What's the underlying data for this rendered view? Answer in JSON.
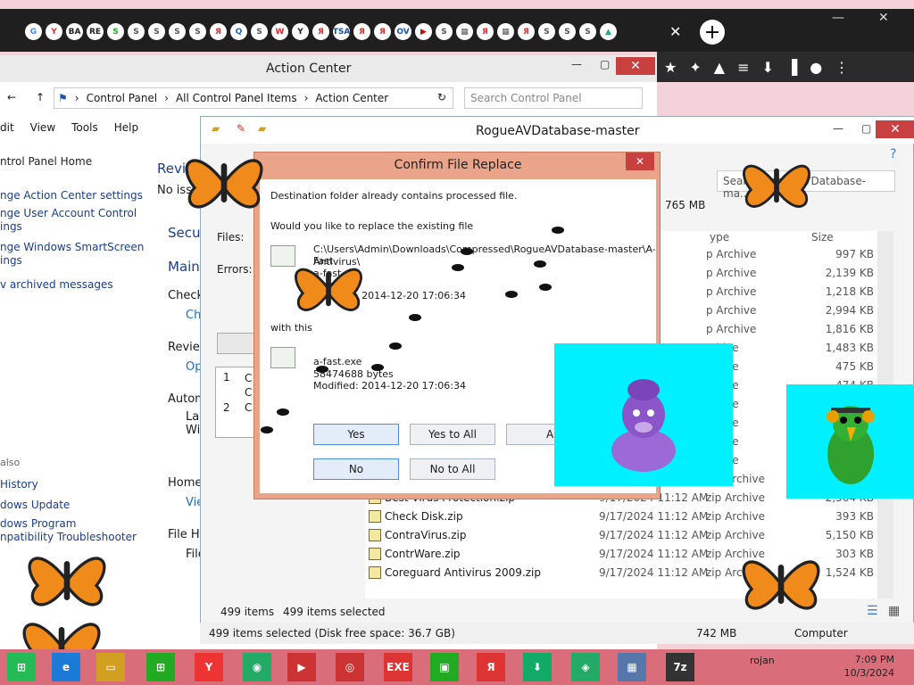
{
  "browser": {
    "tab_icons": [
      "G",
      "Y",
      "BA",
      "RE",
      "S",
      "S",
      "S",
      "S",
      "S",
      "Я",
      "Q",
      "S",
      "W",
      "Y",
      "Я",
      "TSA",
      "Я",
      "Я",
      "OV",
      "▶",
      "S",
      "▦",
      "Я",
      "▦",
      "Я",
      "S",
      "S",
      "S",
      "▲"
    ],
    "tab_close": "✕",
    "new_tab": "+",
    "window_minimize": "—",
    "window_maximize": "▢",
    "window_close": "✕",
    "toolbar_icons": [
      "★",
      "✦",
      "▲",
      "≡",
      "⬇",
      "▐",
      "●",
      "⋮"
    ]
  },
  "action_center": {
    "title": "Action Center",
    "breadcrumb": [
      "Control Panel",
      "All Control Panel Items",
      "Action Center"
    ],
    "search_placeholder": "Search Control Panel",
    "menu": [
      "dit",
      "View",
      "Tools",
      "Help"
    ],
    "nav": {
      "home": "ntrol Panel Home",
      "items": [
        "nge Action Center settings",
        "nge User Account Control\nings",
        "nge Windows SmartScreen\nings",
        "v archived messages"
      ]
    },
    "see_also": {
      "label": "also",
      "items": [
        "History",
        "dows Update",
        "dows Program\nnpatibility Troubleshooter"
      ]
    },
    "middle": {
      "review": "Review",
      "no_issues": "No issu",
      "security": "Secu",
      "maintenance": "Main",
      "check": "Check",
      "check_link": "Ch",
      "review2": "Review",
      "op": "Op",
      "auto": "Autom",
      "la": "La\nWi",
      "home": "Home",
      "vie": "Vie",
      "file_history": "File His",
      "file": "File"
    }
  },
  "explorer": {
    "title": "RogueAVDatabase-master",
    "search": "Search RogueAVDatabase-ma...",
    "status_items": "499 items",
    "status_selected": "499 items selected",
    "bottom_left": "499 items selected (Disk free space: 36.7 GB)",
    "bottom_size": "742 MB",
    "bottom_computer": "Computer",
    "left_labels": [
      "Files:",
      "Errors:"
    ],
    "numbers": [
      "765 MB",
      "0",
      "0"
    ],
    "list_rows": [
      {
        "n": "1",
        "t": "C\nC"
      },
      {
        "n": "2",
        "t": "C"
      }
    ],
    "columns": {
      "type": "ype",
      "size": "Size"
    },
    "rows": [
      {
        "name": "",
        "date": "",
        "type": "p Archive",
        "size": "997 KB"
      },
      {
        "name": "",
        "date": "",
        "type": "p Archive",
        "size": "2,139 KB"
      },
      {
        "name": "",
        "date": "",
        "type": "p Archive",
        "size": "1,218 KB"
      },
      {
        "name": "",
        "date": "",
        "type": "p Archive",
        "size": "2,994 KB"
      },
      {
        "name": "",
        "date": "",
        "type": "p Archive",
        "size": "1,816 KB"
      },
      {
        "name": "",
        "date": "",
        "type": "rchive",
        "size": "1,483 KB"
      },
      {
        "name": "",
        "date": "",
        "type": "rchive",
        "size": "475 KB"
      },
      {
        "name": "",
        "date": "",
        "type": "rchive",
        "size": "474 KB"
      },
      {
        "name": "",
        "date": "",
        "type": "rchive",
        "size": ""
      },
      {
        "name": "",
        "date": "",
        "type": "rchive",
        "size": ""
      },
      {
        "name": "",
        "date": "",
        "type": "rchive",
        "size": ""
      },
      {
        "name": "",
        "date": "",
        "type": "rchive",
        "size": ""
      },
      {
        "name": "Best Malware Protection.zip",
        "date": "9/17/2024 11:12 AM",
        "type": "zip Archive",
        "size": "2,217 KB"
      },
      {
        "name": "Best Virus Protection.zip",
        "date": "9/17/2024 11:12 AM",
        "type": "zip Archive",
        "size": "2,564 KB"
      },
      {
        "name": "Check Disk.zip",
        "date": "9/17/2024 11:12 AM",
        "type": "zip Archive",
        "size": "393 KB"
      },
      {
        "name": "ContraVirus.zip",
        "date": "9/17/2024 11:12 AM",
        "type": "zip Archive",
        "size": "5,150 KB"
      },
      {
        "name": "ContrWare.zip",
        "date": "9/17/2024 11:12 AM",
        "type": "zip Archive",
        "size": "303 KB"
      },
      {
        "name": "Coreguard Antivirus 2009.zip",
        "date": "9/17/2024 11:12 AM",
        "type": "zip Archive",
        "size": "1,524 KB"
      }
    ]
  },
  "dialog": {
    "title": "Confirm File Replace",
    "close": "✕",
    "line1": "Destination folder already contains processed file.",
    "line2": "Would you like to replace the existing file",
    "existing": {
      "path": "C:\\Users\\Admin\\Downloads\\Compressed\\RogueAVDatabase-master\\A-Fast",
      "path2": "Antivirus\\",
      "name": "a-fast.exe",
      "bytes": "bytes",
      "modified": "Modified: 2014-12-20 17:06:34"
    },
    "with_this": "with this",
    "new_file": {
      "name": "a-fast.exe",
      "bytes": "58474688 bytes",
      "modified": "Modified: 2014-12-20 17:06:34"
    },
    "buttons": {
      "yes": "Yes",
      "yes_all": "Yes to All",
      "auto": "Au",
      "no": "No",
      "no_all": "No to All"
    }
  },
  "taskbar": {
    "icons": [
      "⊞",
      "e",
      "▭",
      "⊞",
      "Y",
      "◉",
      "▶",
      "◎",
      "EXE",
      "▣",
      "Я",
      "⬇",
      "◈",
      "▦",
      "7z"
    ],
    "exe_label": "EXE",
    "tray_text": "rojan",
    "clock_time": "7:09 PM",
    "clock_date": "10/3/2024"
  },
  "colors": {
    "taskbar": "#d96e7a",
    "dialog_frame": "#e9a48a",
    "overlay_cyan": "#00f0ff",
    "close_red": "#c94040"
  }
}
